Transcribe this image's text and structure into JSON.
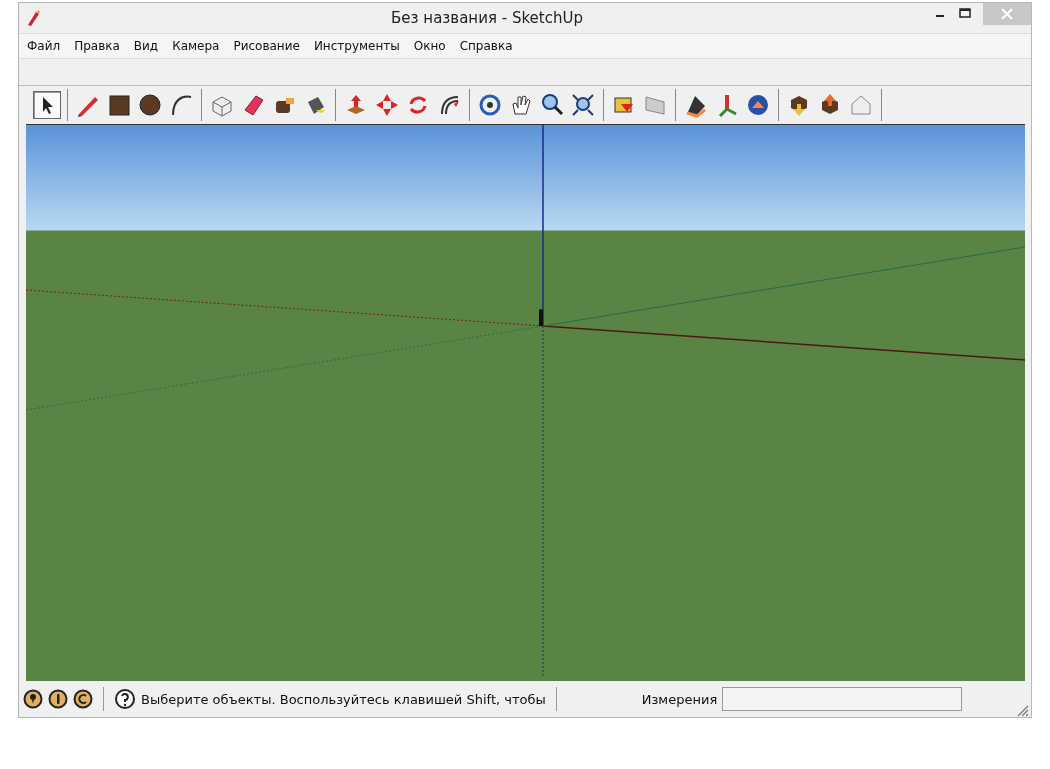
{
  "window": {
    "title": "Без названия - SketchUp"
  },
  "menu": [
    "Файл",
    "Правка",
    "Вид",
    "Камера",
    "Рисование",
    "Инструменты",
    "Окно",
    "Справка"
  ],
  "toolbar": {
    "tools": [
      {
        "selected": true
      },
      {
        "selected": false
      },
      {
        "selected": false
      },
      {
        "selected": false
      },
      {
        "selected": false
      },
      {
        "selected": false
      },
      {
        "selected": false
      },
      {
        "selected": false
      },
      {
        "selected": false
      },
      {
        "selected": false
      },
      {
        "selected": false
      },
      {
        "selected": false
      },
      {
        "selected": false
      },
      {
        "selected": false
      },
      {
        "selected": false
      },
      {
        "selected": false
      },
      {
        "selected": false
      },
      {
        "selected": false
      },
      {
        "selected": false
      },
      {
        "selected": false
      },
      {
        "selected": false
      },
      {
        "selected": false
      },
      {
        "selected": false
      },
      {
        "selected": false
      },
      {
        "selected": false
      }
    ]
  },
  "status_bar": {
    "hint": "Выберите объекты. Воспользуйтесь клавишей Shift, чтобы",
    "measurements_label": "Измерения"
  }
}
